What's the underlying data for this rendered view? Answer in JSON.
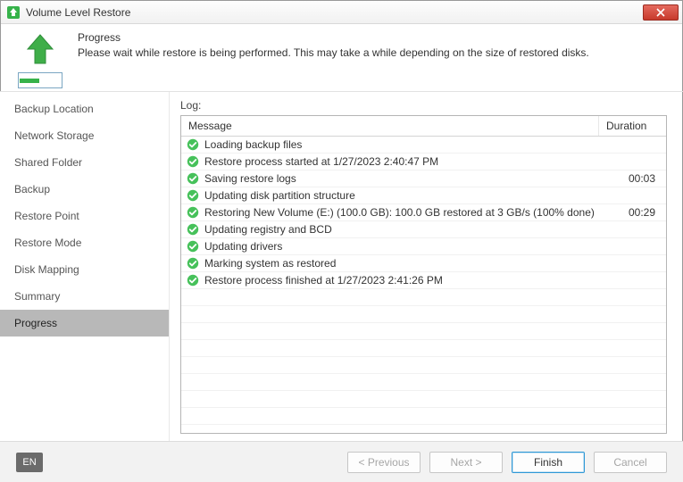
{
  "window": {
    "title": "Volume Level Restore"
  },
  "header": {
    "title": "Progress",
    "description": "Please wait while restore is being performed. This may take a while depending on the size of restored disks."
  },
  "sidebar": {
    "items": [
      {
        "label": "Backup Location",
        "selected": false
      },
      {
        "label": "Network Storage",
        "selected": false
      },
      {
        "label": "Shared Folder",
        "selected": false
      },
      {
        "label": "Backup",
        "selected": false
      },
      {
        "label": "Restore Point",
        "selected": false
      },
      {
        "label": "Restore Mode",
        "selected": false
      },
      {
        "label": "Disk Mapping",
        "selected": false
      },
      {
        "label": "Summary",
        "selected": false
      },
      {
        "label": "Progress",
        "selected": true
      }
    ]
  },
  "log": {
    "label": "Log:",
    "columns": {
      "message": "Message",
      "duration": "Duration"
    },
    "rows": [
      {
        "status": "ok",
        "message": "Loading backup files",
        "duration": ""
      },
      {
        "status": "ok",
        "message": "Restore process started at 1/27/2023 2:40:47 PM",
        "duration": ""
      },
      {
        "status": "ok",
        "message": "Saving restore logs",
        "duration": "00:03"
      },
      {
        "status": "ok",
        "message": "Updating disk partition structure",
        "duration": ""
      },
      {
        "status": "ok",
        "message": "Restoring New Volume (E:) (100.0 GB): 100.0 GB restored at 3 GB/s (100% done)",
        "duration": "00:29"
      },
      {
        "status": "ok",
        "message": "Updating registry and BCD",
        "duration": ""
      },
      {
        "status": "ok",
        "message": "Updating drivers",
        "duration": ""
      },
      {
        "status": "ok",
        "message": "Marking system as restored",
        "duration": ""
      },
      {
        "status": "ok",
        "message": "Restore process finished at 1/27/2023 2:41:26 PM",
        "duration": ""
      }
    ]
  },
  "footer": {
    "language": "EN",
    "buttons": {
      "previous": "< Previous",
      "next": "Next >",
      "finish": "Finish",
      "cancel": "Cancel"
    }
  },
  "colors": {
    "accent_green": "#36b24a",
    "close_red": "#c7392b",
    "selection_gray": "#b8b8b8",
    "finish_border": "#2e98d6"
  }
}
